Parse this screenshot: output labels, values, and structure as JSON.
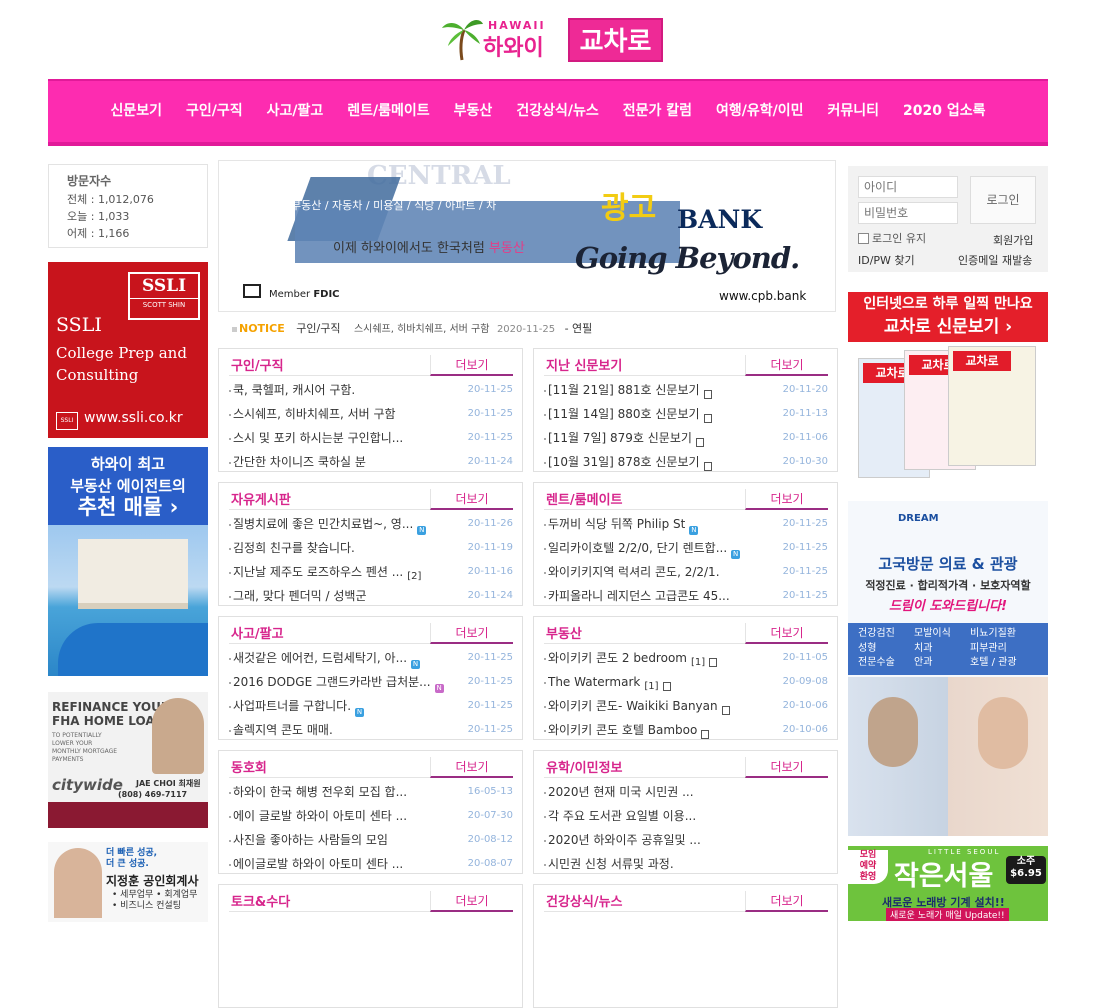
{
  "logo": {
    "en": "HAWAII",
    "ko": "하와이",
    "brand": "교차로"
  },
  "nav": [
    "신문보기",
    "구인/구직",
    "사고/팔고",
    "렌트/룸메이트",
    "부동산",
    "건강상식/뉴스",
    "전문가 칼럼",
    "여행/유학/이민",
    "커뮤니티",
    "2020 업소록"
  ],
  "visitor": {
    "title": "방문자수",
    "total": "전체 : 1,012,076",
    "today": "오늘 : 1,033",
    "yesterday": "어제 : 1,166"
  },
  "ads_left": {
    "ssli": {
      "box1": "SSLI",
      "box2": "SCOTT SHIN",
      "name": "SSLI",
      "sub1": "College Prep and",
      "sub2": "Consulting",
      "mini": "SSLI",
      "url": "www.ssli.co.kr"
    },
    "realty": {
      "line1": "하와이 최고",
      "line2": "부동산 에이전트의",
      "line3": "추천 매물 ›"
    },
    "refi": {
      "t1": "REFINANCE YOUR",
      "t2": "FHA HOME LOAN",
      "t3": "TO POTENTIALLY LOWER YOUR MONTHLY MORTGAGE PAYMENTS",
      "brand": "citywide",
      "name": "JAE CHOI 최재원",
      "phone": "(808) 469-7117"
    },
    "cpa": {
      "s1a": "더 빠른 성공,",
      "s1b": "더 큰 성공.",
      "name": "지정훈 공인회계사",
      "b1": "• 세무업무 • 회계업무",
      "b2": "• 비즈니스 컨설팅"
    }
  },
  "bank": {
    "ghost": "CENTRAL",
    "tag": "부동산 / 자동차 / 미용실 / 식당 / 아파트 / 차",
    "slogan_a": "이제 하와이에서도 한국처럼 ",
    "slogan_b": "부동산",
    "gold": "광고",
    "bankword": "BANK",
    "going": "Going Beyond.",
    "fdic_pre": "Member ",
    "fdic": "FDIC",
    "url": "www.cpb.bank"
  },
  "notice": {
    "label": "NOTICE",
    "category": "구인/구직",
    "title": "스시쉐프, 히바치쉐프, 서버 구함",
    "date": "2020-11-25",
    "tail": "연필"
  },
  "more_label": "더보기",
  "boards": [
    {
      "title": "구인/구직",
      "items": [
        {
          "text": "쿡, 쿡헬퍼, 캐시어 구함.",
          "date": "20-11-25"
        },
        {
          "text": "스시쉐프, 히바치쉐프, 서버 구함",
          "date": "20-11-25"
        },
        {
          "text": "스시 및 포키 하시는분 구인합니...",
          "date": "20-11-25"
        },
        {
          "text": "간단한 차이니즈 쿡하실 분",
          "date": "20-11-24"
        }
      ]
    },
    {
      "title": "지난 신문보기",
      "items": [
        {
          "text": "[11월 21일] 881호 신문보기",
          "date": "20-11-20"
        },
        {
          "text": "[11월 14일] 880호 신문보기",
          "date": "20-11-13"
        },
        {
          "text": "[11월 7일] 879호 신문보기",
          "date": "20-11-06"
        },
        {
          "text": "[10월 31일] 878호 신문보기",
          "date": "20-10-30"
        }
      ]
    },
    {
      "title": "자유게시판",
      "items": [
        {
          "text": "질병치료에 좋은 민간치료법~, 영...",
          "date": "20-11-26",
          "badge": "N"
        },
        {
          "text": "김정희 친구를 찾습니다.",
          "date": "20-11-19"
        },
        {
          "text": "지난날 제주도 로즈하우스 펜션 ...",
          "date": "20-11-16",
          "count": "[2]"
        },
        {
          "text": "그래, 맞다 펜더믹 / 성백군",
          "date": "20-11-24"
        }
      ]
    },
    {
      "title": "렌트/룸메이트",
      "items": [
        {
          "text": "두꺼비 식당 뒤쪽 Philip St",
          "date": "20-11-25",
          "badge": "N"
        },
        {
          "text": "일리카이호텔 2/2/0, 단기 렌트합...",
          "date": "20-11-25",
          "badge": "N"
        },
        {
          "text": "와이키키지역 럭셔리 콘도, 2/2/1.",
          "date": "20-11-25"
        },
        {
          "text": "카피올라니 레지던스 고급콘도 45...",
          "date": "20-11-25"
        }
      ]
    },
    {
      "title": "사고/팔고",
      "items": [
        {
          "text": "새것같은 에어컨, 드럼세탁기, 아...",
          "date": "20-11-25",
          "badge": "N"
        },
        {
          "text": "2016 DODGE 그랜드카라반 급처분...",
          "date": "20-11-25",
          "badge": "N",
          "badge_pink": true
        },
        {
          "text": "사업파트너를 구합니다.",
          "date": "20-11-25",
          "badge": "N"
        },
        {
          "text": "솔렉지역 콘도 매매.",
          "date": "20-11-25"
        }
      ]
    },
    {
      "title": "부동산",
      "items": [
        {
          "text": "와이키키 콘도 2 bedroom",
          "date": "20-11-05",
          "count": "[1]"
        },
        {
          "text": "The Watermark",
          "date": "20-09-08",
          "count": "[1]"
        },
        {
          "text": "와이키키 콘도- Waikiki Banyan",
          "date": "20-10-06"
        },
        {
          "text": "와이키키 콘도 호텔 Bamboo",
          "date": "20-10-06"
        }
      ]
    },
    {
      "title": "동호회",
      "items": [
        {
          "text": "하와이 한국 해병 전우회 모집 합...",
          "date": "16-05-13"
        },
        {
          "text": "에이 글로발 하와이 아토미 센타 ...",
          "date": "20-07-30"
        },
        {
          "text": "사진을 좋아하는 사람들의 모임",
          "date": "20-08-12"
        },
        {
          "text": "에이글로발 하와이 아토미 센타 ...",
          "date": "20-08-07"
        }
      ]
    },
    {
      "title": "유학/이민정보",
      "items": [
        {
          "text": "2020년 현재 미국 시민권 ...",
          "date": ""
        },
        {
          "text": "각 주요 도서관 요일별 이용...",
          "date": ""
        },
        {
          "text": "2020년 하와이주 공휴일및 ...",
          "date": ""
        },
        {
          "text": "시민권 신청 서류및 과정.",
          "date": ""
        }
      ]
    },
    {
      "title": "토크&수다",
      "items": []
    },
    {
      "title": "건강상식/뉴스",
      "items": []
    }
  ],
  "login": {
    "id_placeholder": "아이디",
    "pw_placeholder": "비밀번호",
    "button": "로그인",
    "keep": "로그인 유지",
    "join": "회원가입",
    "find": "ID/PW 찾기",
    "resend": "인증메일 재발송"
  },
  "ads_right": {
    "news": {
      "line1": "인터넷으로 하루 일찍 만나요",
      "line2": "교차로 신문보기 ›",
      "mast": "교차로"
    },
    "dream": {
      "logo": "DREAM",
      "t1": "고국방문 의료 & 관광",
      "t2": "적정진료 · 합리적가격 · 보호자역할",
      "t3": "드림이 도와드립니다!",
      "grid": [
        "건강검진",
        "모발이식",
        "비뇨기질환",
        "성형",
        "치과",
        "피부관리",
        "전문수술",
        "안과",
        "호텔 / 관광"
      ]
    },
    "norae": {
      "ls": "LITTLE SEOUL",
      "big": "작은서울",
      "tag1": "모임",
      "tag2": "예약",
      "tag3": "환영",
      "price1": "소주",
      "price2": "$6.95",
      "s1": "새로운 노래방 기계 설치!!",
      "s2": "새로운 노래가 매일 Update!!"
    }
  }
}
